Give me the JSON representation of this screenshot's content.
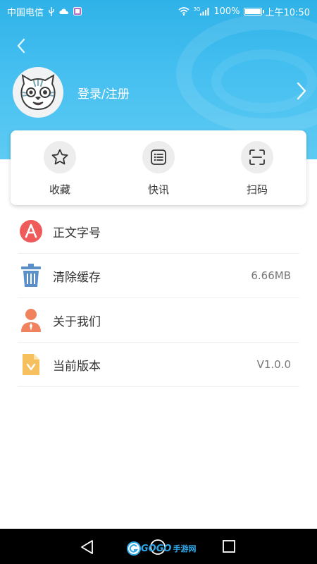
{
  "status_bar": {
    "carrier": "中国电信",
    "network_label": "3G",
    "battery_percent": "100%",
    "battery_level": 1.0,
    "time": "上午10:50"
  },
  "header": {
    "login_label": "登录/注册",
    "accent_color": "#3dbbee"
  },
  "quick_actions": [
    {
      "label": "收藏",
      "icon": "star-icon"
    },
    {
      "label": "快讯",
      "icon": "list-icon"
    },
    {
      "label": "扫码",
      "icon": "scan-icon"
    }
  ],
  "settings": [
    {
      "label": "正文字号",
      "value": "",
      "icon": "font-size-icon"
    },
    {
      "label": "清除缓存",
      "value": "6.66MB",
      "icon": "trash-icon"
    },
    {
      "label": "关于我们",
      "value": "",
      "icon": "person-icon"
    },
    {
      "label": "当前版本",
      "value": "V1.0.0",
      "icon": "document-icon"
    }
  ],
  "watermark": {
    "text": "GOGO",
    "text2": "手游网"
  }
}
